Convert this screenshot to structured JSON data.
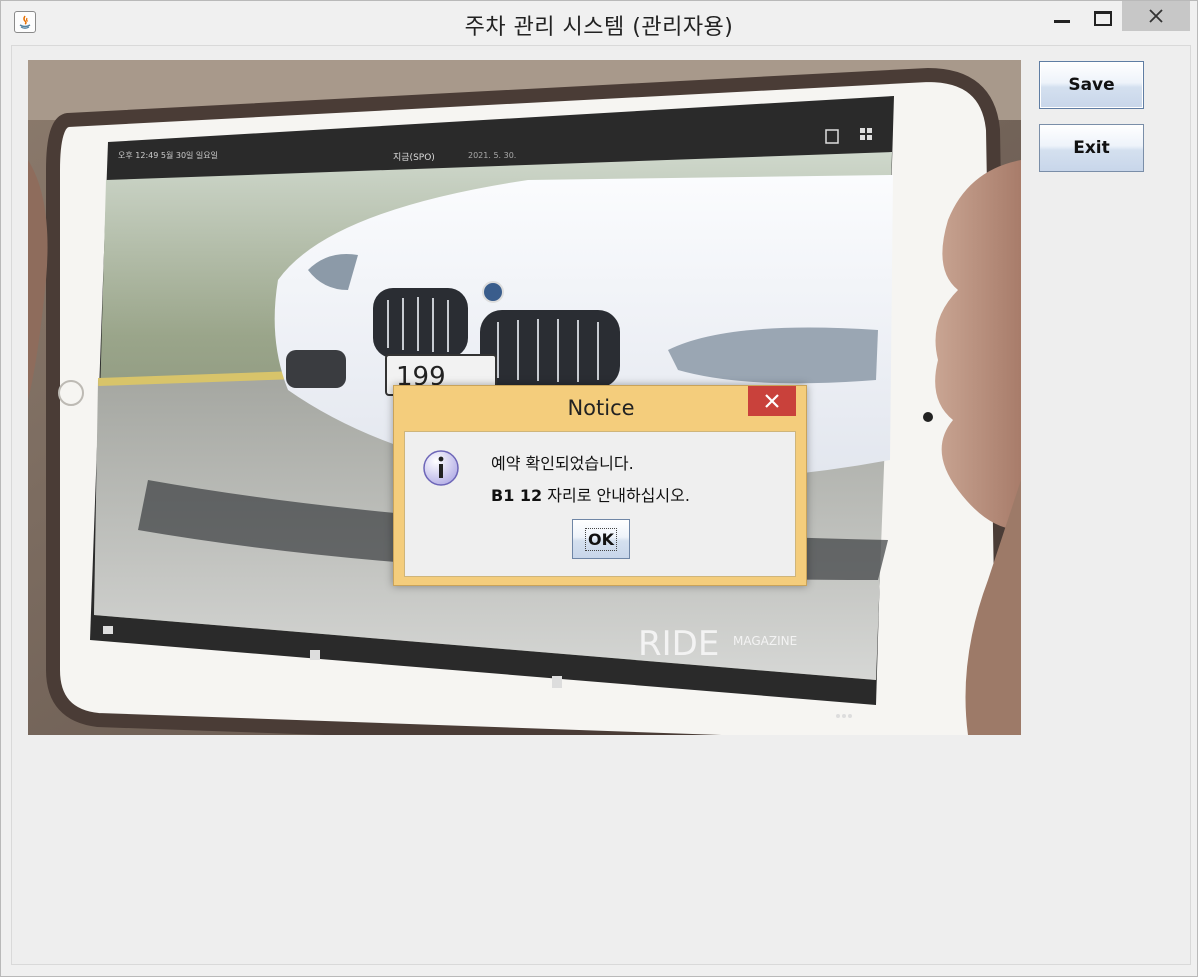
{
  "window": {
    "title": "주차 관리 시스템 (관리자용)",
    "controls": [
      "minimize-icon",
      "maximize-icon",
      "close-icon"
    ]
  },
  "camera_feed": {
    "tablet_status": {
      "center_label": "지금(SPO)",
      "date": "2021. 5. 30."
    },
    "plate_partial": "199",
    "watermark_main": "RIDE",
    "watermark_sub": "MAGAZINE"
  },
  "buttons": {
    "save_label": "Save",
    "exit_label": "Exit"
  },
  "dialog": {
    "title": "Notice",
    "line1": "예약 확인되었습니다.",
    "line2_bold": "B1 12",
    "line2_rest": " 자리로 안내하십시오.",
    "ok_label": "OK",
    "icon": "info-icon"
  },
  "colors": {
    "dialog_frame": "#f4cd7c",
    "dialog_close": "#c9413b",
    "window_bg": "#f0f0f0"
  }
}
